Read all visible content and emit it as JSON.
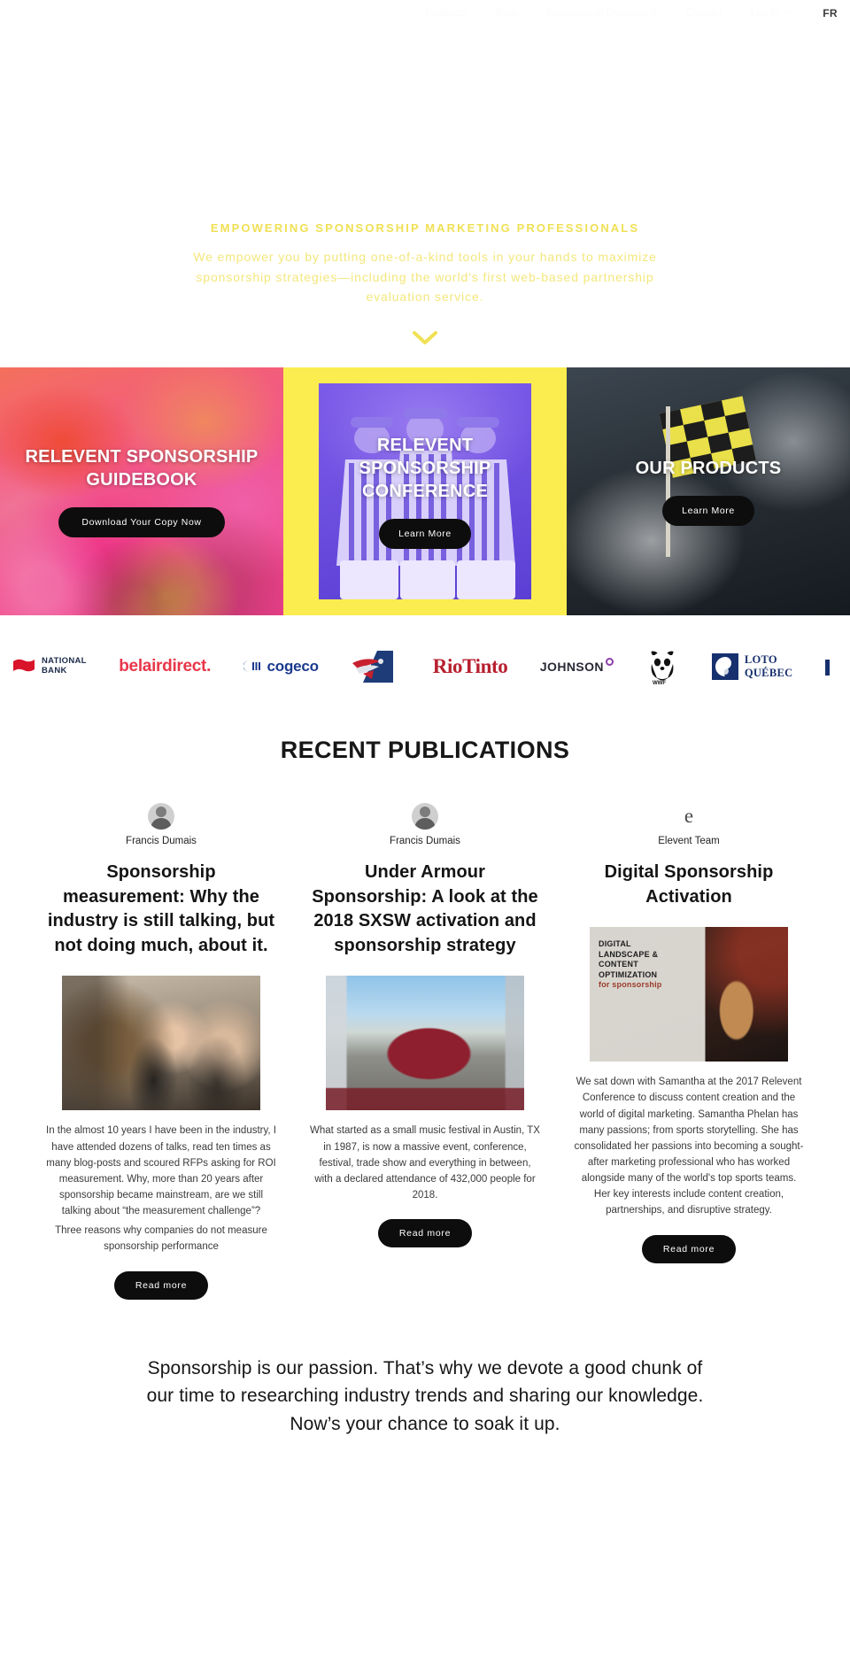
{
  "nav": {
    "items": [
      {
        "label": "Products"
      },
      {
        "label": "Blog"
      },
      {
        "label": "Sponsorship Guidebook"
      },
      {
        "label": "Contact"
      },
      {
        "label": "Log in"
      }
    ],
    "lang_switch": "FR"
  },
  "hero": {
    "eyebrow": "EMPOWERING SPONSORSHIP MARKETING PROFESSIONALS",
    "subtitle": "We empower you by putting one-of-a-kind tools in your hands to maximize sponsorship strategies—including the world's first web-based partnership evaluation service.",
    "scroll_icon": "chevron-down-icon"
  },
  "tiles": [
    {
      "title": "RELEVENT SPONSORSHIP GUIDEBOOK",
      "cta": "Download Your Copy Now",
      "background": "color-smoke-crowd"
    },
    {
      "title": "RELEVENT SPONSORSHIP CONFERENCE",
      "cta": "Learn More",
      "background": "referees-purple",
      "frame_color": "#fbec4f"
    },
    {
      "title": "OUR PRODUCTS",
      "cta": "Learn More",
      "background": "checkered-flag-smoke"
    }
  ],
  "logos": [
    {
      "name": "National Bank",
      "line1": "NATIONAL",
      "line2": "BANK"
    },
    {
      "name": "belairdirect",
      "text": "belairdirect."
    },
    {
      "name": "Cogeco",
      "text": "cogeco"
    },
    {
      "name": "Montreal Alouettes",
      "text": ""
    },
    {
      "name": "Rio Tinto",
      "text": "RioTinto"
    },
    {
      "name": "Johnson",
      "text": "JOHNSON"
    },
    {
      "name": "WWF",
      "text": "WWF"
    },
    {
      "name": "Loto-Québec",
      "line1": "LOTO",
      "line2": "QUÉBEC"
    }
  ],
  "publications": {
    "heading": "RECENT PUBLICATIONS",
    "cards": [
      {
        "author": "Francis Dumais",
        "avatar_type": "photo",
        "title": "Sponsorship measurement: Why the industry is still talking, but not doing much, about it.",
        "image": "panel-discussion-photo",
        "body": "In the almost 10 years I have been in the industry, I have attended dozens of talks, read ten times as many blog-posts and scoured RFPs asking for ROI measurement. Why, more than 20 years after sponsorship became mainstream, are we still talking about “the measurement challenge”?",
        "body_bold": "Three reasons why companies do not measure sponsorship performance",
        "cta": "Read more"
      },
      {
        "author": "Francis Dumais",
        "avatar_type": "photo",
        "title": "Under Armour Sponsorship: A look at the 2018 SXSW activation and sponsorship strategy",
        "image": "sxsw-dome-photo",
        "body": "What started as a small music festival in Austin, TX in 1987, is now a massive event, conference, festival, trade show and everything in between, with a declared attendance of 432,000 people for 2018.",
        "body_bold": "",
        "cta": "Read more"
      },
      {
        "author": "Elevent Team",
        "avatar_type": "letter",
        "avatar_letter": "e",
        "title": "Digital Sponsorship Activation",
        "image": "conference-stage-photo",
        "image_caption_line1": "DIGITAL",
        "image_caption_line2": "LANDSCAPE &",
        "image_caption_line3": "CONTENT",
        "image_caption_line4": "OPTIMIZATION",
        "image_caption_accent": "for sponsorship",
        "body": "We sat down with Samantha at the 2017 Relevent Conference to discuss content creation and the world of digital marketing. Samantha Phelan has many passions; from sports storytelling. She has consolidated her passions into becoming a sought-after marketing professional who has worked alongside many of the world's top sports teams. Her key interests include content creation, partnerships, and disruptive strategy.",
        "body_bold": "",
        "cta": "Read more"
      }
    ]
  },
  "closing": {
    "text": "Sponsorship is our passion. That’s why we devote a good chunk of our time to researching industry trends and sharing our knowledge. Now’s your chance to soak it up."
  },
  "colors": {
    "accent_yellow": "#fbec4f",
    "hero_text_yellow": "#f0e055",
    "dark_button": "#0d0d0d"
  }
}
